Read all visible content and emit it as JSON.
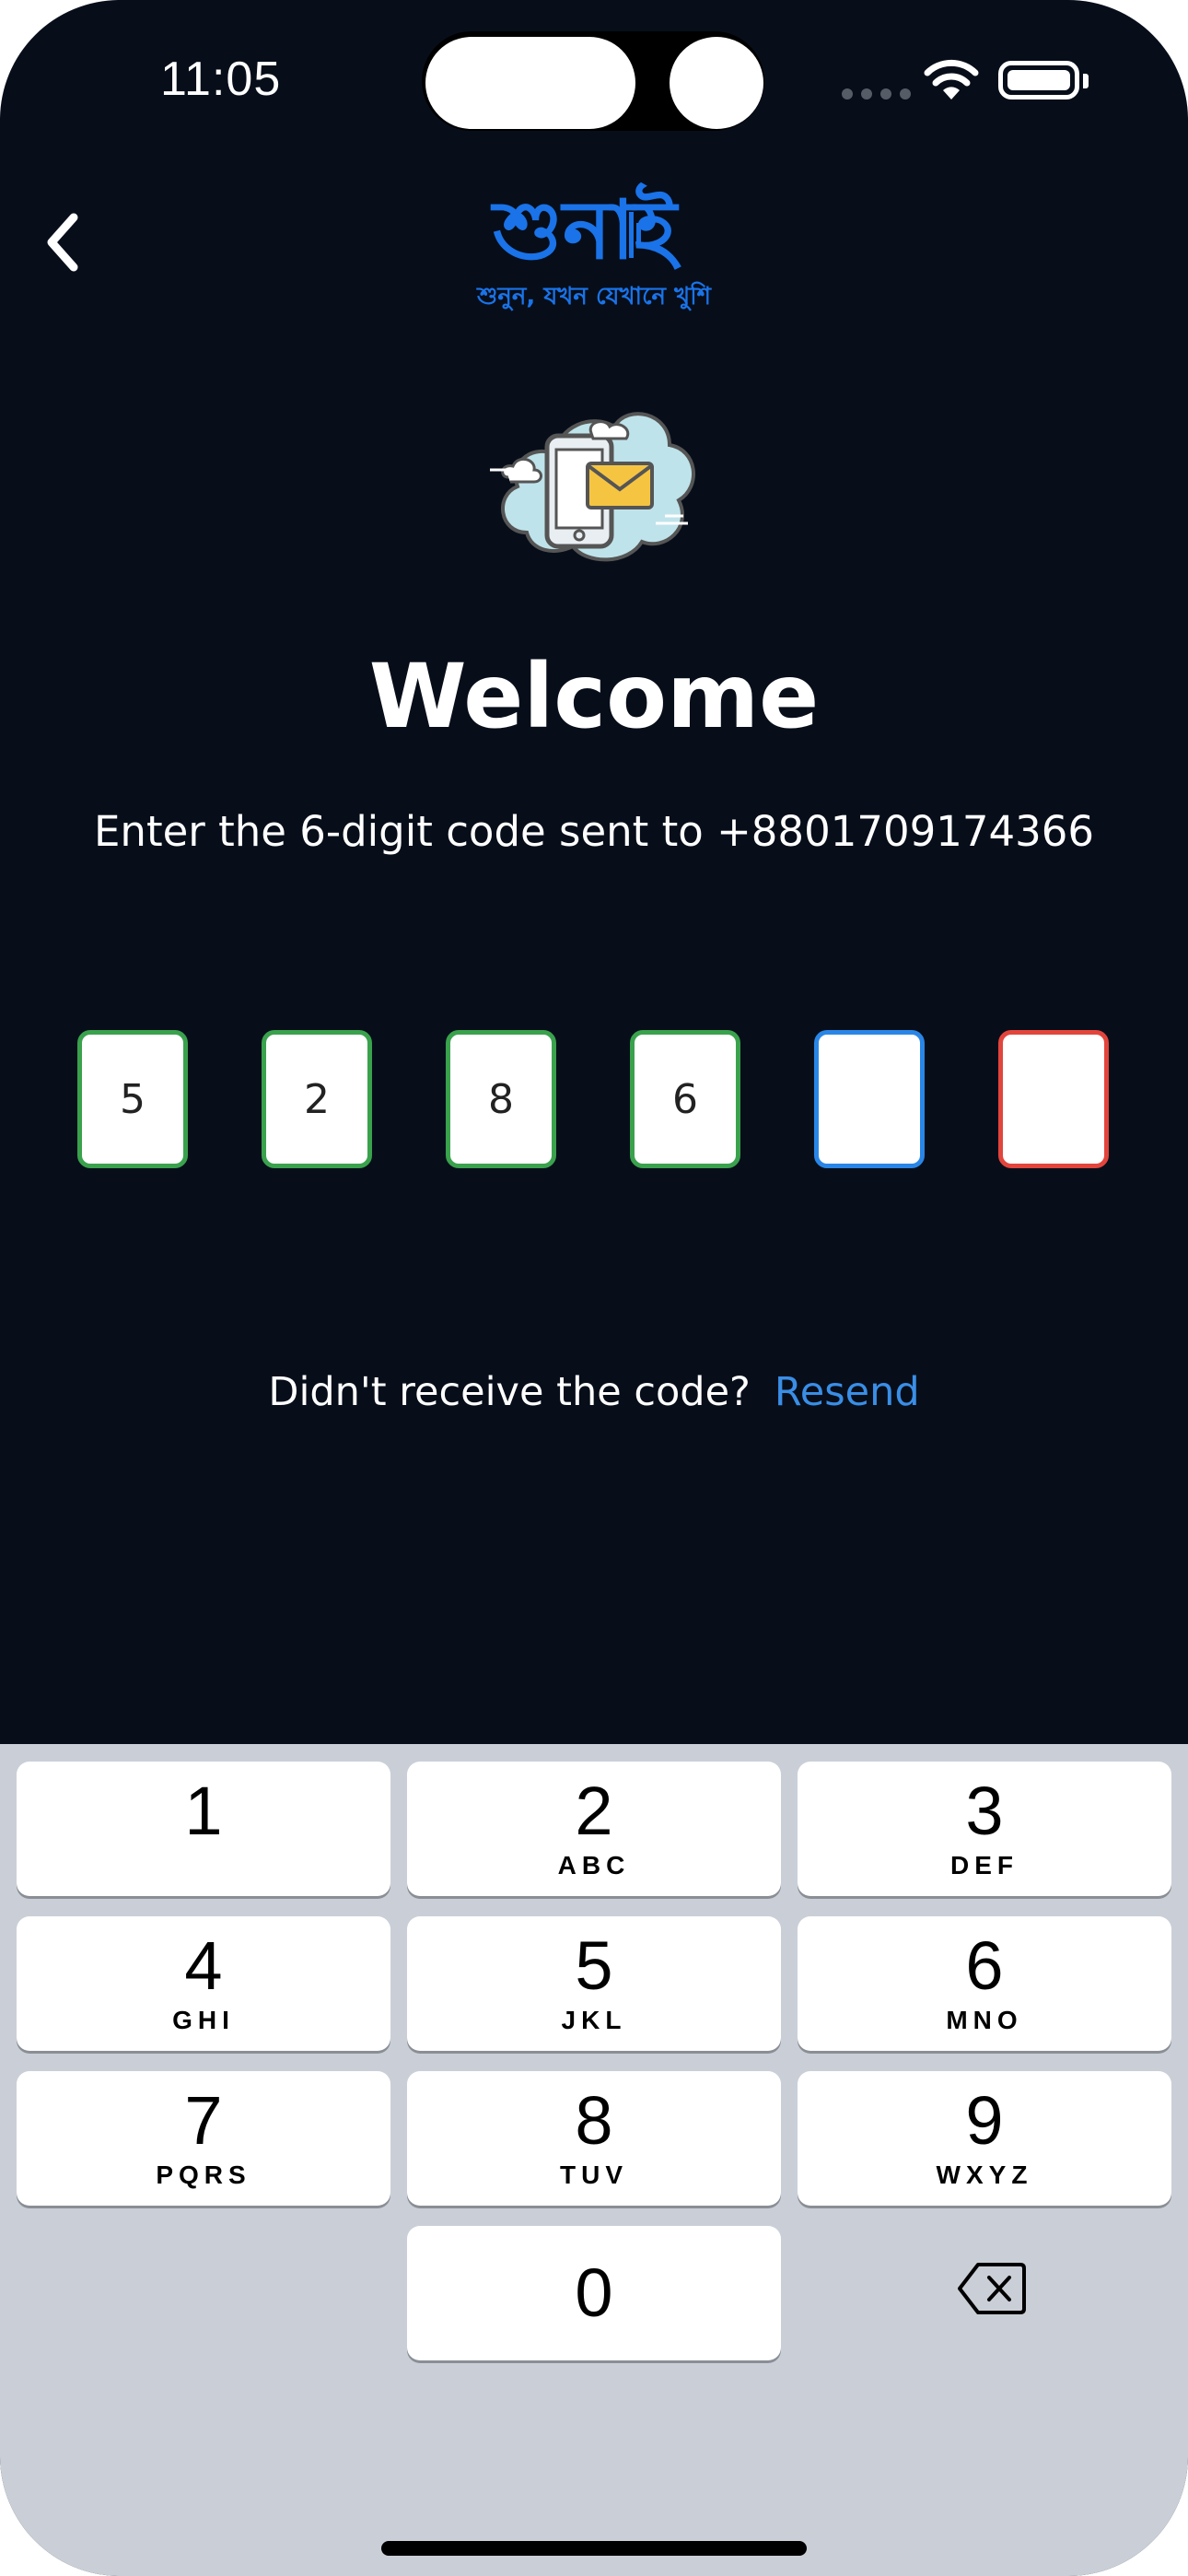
{
  "status_bar": {
    "time": "11:05"
  },
  "header": {
    "logo_text": "শুনাই",
    "logo_tagline": "শুনুন, যখন যেখানে খুশি"
  },
  "welcome": {
    "title": "Welcome",
    "subtitle": "Enter the 6-digit code sent to +8801709174366"
  },
  "otp": {
    "digits": [
      "5",
      "2",
      "8",
      "6",
      "",
      ""
    ],
    "states": [
      "filled",
      "filled",
      "filled",
      "filled",
      "active",
      "error"
    ]
  },
  "resend": {
    "question": "Didn't receive the code?",
    "link": "Resend"
  },
  "keyboard": {
    "keys": [
      {
        "num": "1",
        "letters": ""
      },
      {
        "num": "2",
        "letters": "ABC"
      },
      {
        "num": "3",
        "letters": "DEF"
      },
      {
        "num": "4",
        "letters": "GHI"
      },
      {
        "num": "5",
        "letters": "JKL"
      },
      {
        "num": "6",
        "letters": "MNO"
      },
      {
        "num": "7",
        "letters": "PQRS"
      },
      {
        "num": "8",
        "letters": "TUV"
      },
      {
        "num": "9",
        "letters": "WXYZ"
      },
      {
        "num": "0",
        "letters": ""
      }
    ]
  },
  "colors": {
    "background": "#070e1a",
    "brand_blue": "#1a73e8",
    "otp_filled": "#3aa14d",
    "otp_active": "#2a86e6",
    "otp_error": "#e2453c",
    "link": "#3a8ee6",
    "keyboard_bg": "#cacfd7"
  },
  "icons": [
    "back-chevron-icon",
    "wifi-icon",
    "battery-icon",
    "phone-mail-cloud-illustration",
    "delete-backspace-icon"
  ]
}
